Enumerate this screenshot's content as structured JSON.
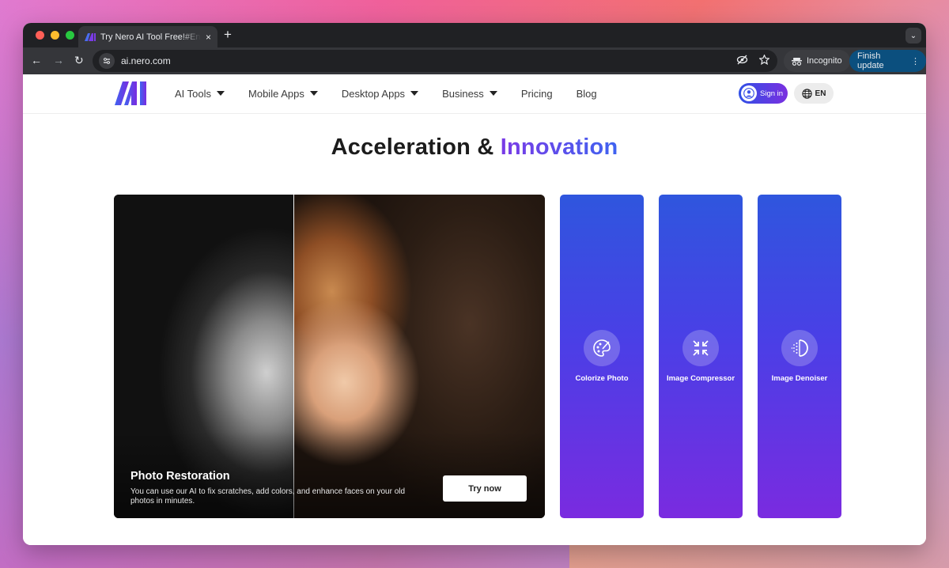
{
  "browser": {
    "tab_title": "Try Nero AI Tool Free!#Enlarge",
    "tab_close": "×",
    "new_tab": "+",
    "tab_menu": "⌄",
    "url": "ai.nero.com",
    "incognito_label": "Incognito",
    "finish_update_label": "Finish update",
    "menu_glyph": "⋮",
    "back_glyph": "←",
    "forward_glyph": "→",
    "reload_glyph": "↻"
  },
  "site": {
    "nav": {
      "items": [
        {
          "label": "AI Tools",
          "has_dropdown": true
        },
        {
          "label": "Mobile Apps",
          "has_dropdown": true
        },
        {
          "label": "Desktop Apps",
          "has_dropdown": true
        },
        {
          "label": "Business",
          "has_dropdown": true
        },
        {
          "label": "Pricing",
          "has_dropdown": false
        },
        {
          "label": "Blog",
          "has_dropdown": false
        }
      ],
      "signin_label": "Sign in",
      "lang_label": "EN"
    },
    "headline": {
      "part1": "Acceleration & ",
      "part2": "Innovation"
    },
    "hero": {
      "title": "Photo Restoration",
      "description": "You can use our AI to fix scratches, add colors, and enhance faces on your old photos in minutes.",
      "button_label": "Try now"
    },
    "tools": [
      {
        "label": "Colorize Photo",
        "icon": "palette-icon"
      },
      {
        "label": "Image Compressor",
        "icon": "compress-icon"
      },
      {
        "label": "Image Denoiser",
        "icon": "denoise-icon"
      }
    ]
  },
  "colors": {
    "accent_start": "#7a3be6",
    "accent_end": "#3f63f0",
    "card_top": "#2f56de",
    "card_bottom": "#7a2be0"
  }
}
